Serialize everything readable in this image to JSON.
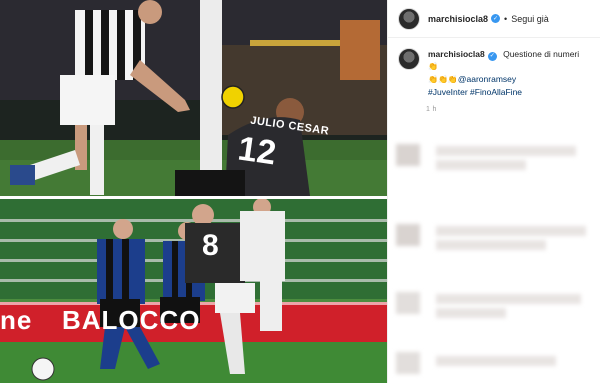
{
  "post": {
    "username": "marchisiocla8",
    "follow_label": "Segui già",
    "caption_text": "Questione di numeri",
    "caption_line2": "👏",
    "caption_line3_emoji": "👏👏👏",
    "caption_mention": "@aaronramsey",
    "caption_hashtags": "#JuveInter #FinoAllaFine",
    "timestamp": "1 h"
  },
  "photos": {
    "top": {
      "shirt_name": "JULIO CESAR",
      "shirt_number": "12"
    },
    "bottom": {
      "shirt_number": "8",
      "banner_text": "BALOCCO",
      "banner_left": "ne"
    }
  },
  "icons": {
    "verified": "verified-badge-icon"
  },
  "colors": {
    "verified": "#3897f0",
    "hashtag": "#003569",
    "banner": "#d0202a"
  }
}
